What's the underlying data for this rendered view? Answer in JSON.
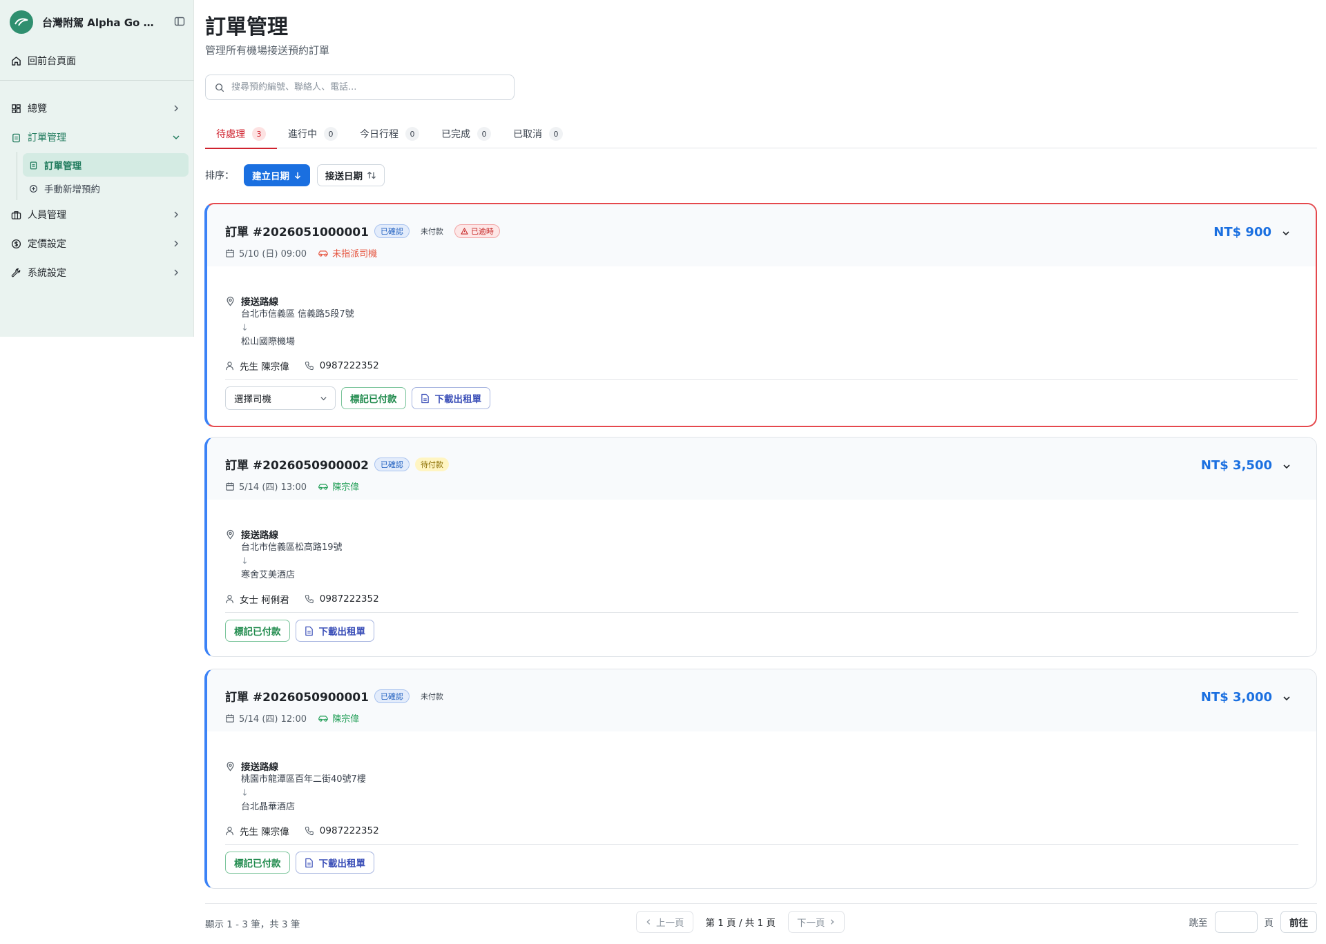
{
  "sidebar": {
    "brand": "台灣附駕 Alpha Go 線上預約系統",
    "back_label": "回前台頁面",
    "items": [
      {
        "label": "總覽"
      },
      {
        "label": "訂單管理"
      },
      {
        "label": "人員管理"
      },
      {
        "label": "定價設定"
      },
      {
        "label": "系統設定"
      }
    ],
    "sub_items": [
      {
        "label": "訂單管理"
      },
      {
        "label": "手動新增預約"
      }
    ]
  },
  "header": {
    "title": "訂單管理",
    "subtitle": "管理所有機場接送預約訂單"
  },
  "search": {
    "placeholder": "搜尋預約編號、聯絡人、電話..."
  },
  "tabs": [
    {
      "label": "待處理",
      "count": "3"
    },
    {
      "label": "進行中",
      "count": "0"
    },
    {
      "label": "今日行程",
      "count": "0"
    },
    {
      "label": "已完成",
      "count": "0"
    },
    {
      "label": "已取消",
      "count": "0"
    }
  ],
  "sort": {
    "label": "排序：",
    "created": "建立日期",
    "pickup": "接送日期"
  },
  "orders": [
    {
      "title": "訂單 #2026051000001",
      "status": "已確認",
      "payment": "未付款",
      "overdue": "已逾時",
      "datetime": "5/10 (日) 09:00",
      "driver": "未指派司機",
      "price": "NT$ 900",
      "route_label": "接送路線",
      "from": "台北市信義區 信義路5段7號",
      "arrow": "↓",
      "to": "松山國際機場",
      "contact": "先生 陳宗偉",
      "phone": "0987222352",
      "select_driver": "選擇司機",
      "mark_paid": "標記已付款",
      "download": "下載出租單"
    },
    {
      "title": "訂單 #2026050900002",
      "status": "已確認",
      "payment": "待付款",
      "datetime": "5/14 (四) 13:00",
      "driver": "陳宗偉",
      "price": "NT$ 3,500",
      "route_label": "接送路線",
      "from": "台北市信義區松高路19號",
      "arrow": "↓",
      "to": "寒舍艾美酒店",
      "contact": "女士 柯俐君",
      "phone": "0987222352",
      "mark_paid": "標記已付款",
      "download": "下載出租單"
    },
    {
      "title": "訂單 #2026050900001",
      "status": "已確認",
      "payment": "未付款",
      "datetime": "5/14 (四) 12:00",
      "driver": "陳宗偉",
      "price": "NT$ 3,000",
      "route_label": "接送路線",
      "from": "桃園市龍潭區百年二街40號7樓",
      "arrow": "↓",
      "to": "台北晶華酒店",
      "contact": "先生 陳宗偉",
      "phone": "0987222352",
      "mark_paid": "標記已付款",
      "download": "下載出租單"
    }
  ],
  "pagination": {
    "summary": "顯示 1 - 3 筆，共 3 筆",
    "prev": "上一頁",
    "info": "第 1 頁 / 共 1 頁",
    "next": "下一頁",
    "jump_label": "跳至",
    "page_unit": "頁",
    "go": "前往"
  },
  "colors": {
    "brand_green": "#2f8f6f",
    "accent_blue": "#1a6fe0",
    "danger_red": "#e5484d",
    "card_stripe": "#3b82f6"
  }
}
